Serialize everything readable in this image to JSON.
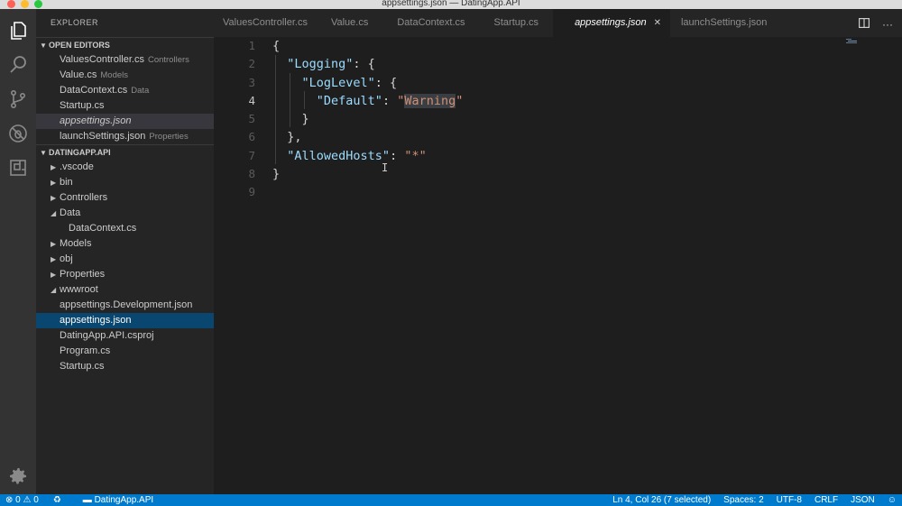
{
  "window": {
    "title": "appsettings.json — DatingApp.API"
  },
  "colors": {
    "accent": "#007acc",
    "close": "#fe5f57",
    "minimize": "#febc2e",
    "zoom": "#28c840"
  },
  "activity_bar": {
    "icons": [
      "explorer-icon",
      "search-icon",
      "source-control-icon",
      "debug-icon",
      "extensions-icon",
      "gear-icon"
    ]
  },
  "sidebar": {
    "header": "EXPLORER",
    "open_editors": {
      "title": "OPEN EDITORS",
      "items": [
        {
          "name": "ValuesController.cs",
          "desc": "Controllers"
        },
        {
          "name": "Value.cs",
          "desc": "Models"
        },
        {
          "name": "DataContext.cs",
          "desc": "Data"
        },
        {
          "name": "Startup.cs",
          "desc": ""
        },
        {
          "name": "appsettings.json",
          "desc": ""
        },
        {
          "name": "launchSettings.json",
          "desc": "Properties"
        }
      ]
    },
    "project": {
      "title": "DATINGAPP.API",
      "items": [
        {
          "name": ".vscode"
        },
        {
          "name": "bin"
        },
        {
          "name": "Controllers"
        },
        {
          "name": "Data"
        },
        {
          "name": "DataContext.cs"
        },
        {
          "name": "Models"
        },
        {
          "name": "obj"
        },
        {
          "name": "Properties"
        },
        {
          "name": "wwwroot"
        },
        {
          "name": "appsettings.Development.json"
        },
        {
          "name": "appsettings.json"
        },
        {
          "name": "DatingApp.API.csproj"
        },
        {
          "name": "Program.cs"
        },
        {
          "name": "Startup.cs"
        }
      ]
    }
  },
  "tabs": [
    {
      "label": "ValuesController.cs"
    },
    {
      "label": "Value.cs"
    },
    {
      "label": "DataContext.cs"
    },
    {
      "label": "Startup.cs"
    },
    {
      "label": "appsettings.json",
      "close": "✕"
    },
    {
      "label": "launchSettings.json"
    }
  ],
  "editor": {
    "line_numbers": [
      "1",
      "2",
      "3",
      "4",
      "5",
      "6",
      "7",
      "8",
      "9"
    ],
    "current_line": "4",
    "code": {
      "l1": "{",
      "l2_key": "\"Logging\"",
      "l2_rest": ": {",
      "l3_key": "\"LogLevel\"",
      "l3_rest": ": {",
      "l4_key": "\"Default\"",
      "l4_colon": ": ",
      "l4_q1": "\"",
      "l4_sel": "Warning",
      "l4_q2": "\"",
      "l5": "}",
      "l6": "},",
      "l7_key": "\"AllowedHosts\"",
      "l7_colon": ": ",
      "l7_val": "\"*\"",
      "l8": "}"
    }
  },
  "statusbar": {
    "errors": "0",
    "warnings": "0",
    "folder": "DatingApp.API",
    "position": "Ln 4, Col 26 (7 selected)",
    "spaces": "Spaces: 2",
    "encoding": "UTF-8",
    "eol": "CRLF",
    "language": "JSON"
  }
}
